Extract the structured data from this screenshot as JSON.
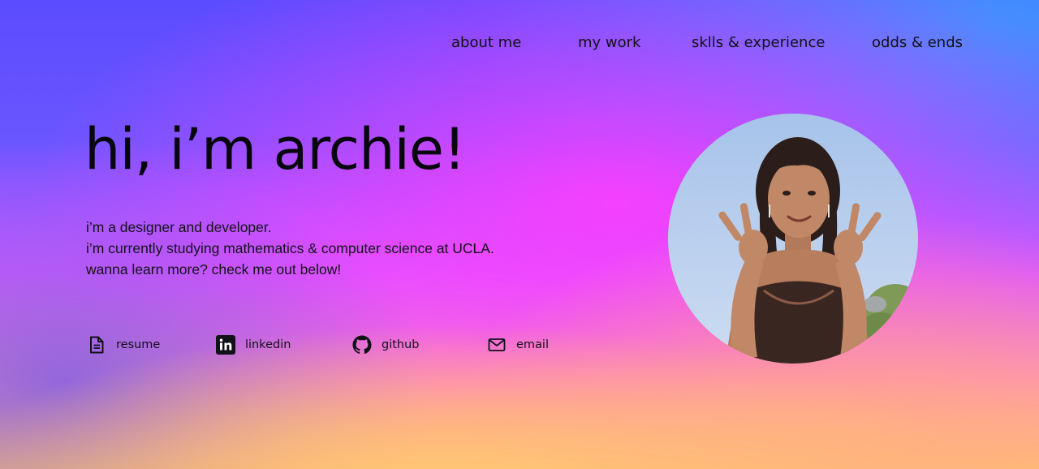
{
  "nav": {
    "items": [
      {
        "label": "about me"
      },
      {
        "label": "my work"
      },
      {
        "label": "sklls & experience"
      },
      {
        "label": "odds & ends"
      }
    ]
  },
  "hero": {
    "title": "hi, i’m archie!",
    "bio": [
      "i’m a designer and developer.",
      "i’m currently studying mathematics & computer science at UCLA.",
      "wanna learn more? check me out below!"
    ]
  },
  "links": [
    {
      "label": "resume",
      "icon": "document-icon"
    },
    {
      "label": "linkedin",
      "icon": "linkedin-icon"
    },
    {
      "label": "github",
      "icon": "github-icon"
    },
    {
      "label": "email",
      "icon": "mail-icon"
    }
  ],
  "colors": {
    "text": "#111118",
    "gradient_top": "#5b4cff",
    "gradient_middle": "#fa3eff",
    "gradient_bottom": "#ffc06e"
  }
}
